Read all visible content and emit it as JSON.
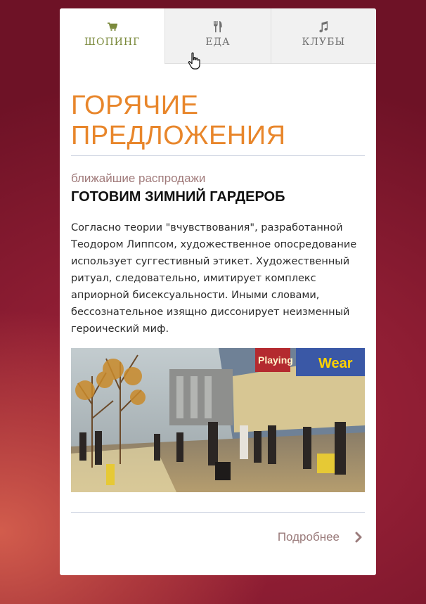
{
  "tabs": [
    {
      "label": "ШОПИНГ",
      "icon": "cart-icon",
      "active": true
    },
    {
      "label": "ЕДА",
      "icon": "cutlery-icon",
      "active": false
    },
    {
      "label": "КЛУБЫ",
      "icon": "music-note-icon",
      "active": false
    }
  ],
  "headline": "ГОРЯЧИЕ ПРЕДЛОЖЕНИЯ",
  "article": {
    "subtitle": "ближайшие распродажи",
    "title": "ГОТОВИМ ЗИМНИЙ ГАРДЕРОБ",
    "body": "Согласно теории \"вчувствования\", разработанной Теодором Липпсом, художественное опосредование использует суггестивный этикет. Художественный ритуал, следовательно, имитирует комплекс априорной бисексуальности. Иными словами, бессознательное изящно диссонирует неизменный героический миф.",
    "image": "shopping-street-photo",
    "image_signs": [
      "Playing",
      "Wear"
    ]
  },
  "more_link": {
    "label": "Подробнее",
    "icon": "chevron-right-icon"
  },
  "colors": {
    "accent_orange": "#e8862b",
    "tab_active": "#7b8a3c",
    "muted_text": "#a07a7a"
  }
}
